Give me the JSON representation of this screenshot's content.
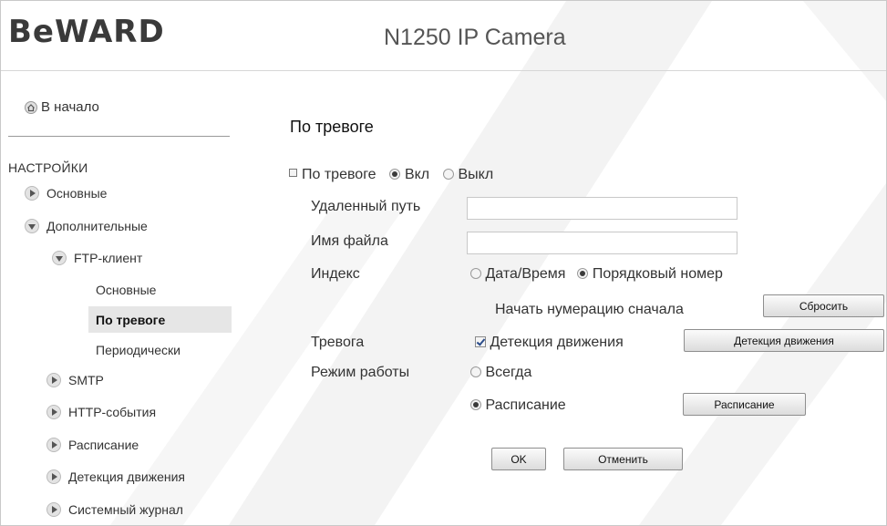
{
  "header": {
    "logo": "BeWARD",
    "title": "N1250 IP Camera"
  },
  "sidebar": {
    "home_label": "В начало",
    "section_title": "НАСТРОЙКИ",
    "items": [
      {
        "label": "Основные"
      },
      {
        "label": "Дополнительные"
      },
      {
        "label": "FTP-клиент"
      },
      {
        "label": "Основные"
      },
      {
        "label": "По тревоге"
      },
      {
        "label": "Периодически"
      },
      {
        "label": "SMTP"
      },
      {
        "label": "HTTP-события"
      },
      {
        "label": "Расписание"
      },
      {
        "label": "Детекция движения"
      },
      {
        "label": "Системный журнал"
      }
    ],
    "active_item": "По тревоге"
  },
  "form": {
    "title": "По тревоге",
    "alarm": {
      "label": "По тревоге",
      "on_label": "Вкл",
      "off_label": "Выкл",
      "value": "Вкл"
    },
    "remote_path": {
      "label": "Удаленный путь",
      "value": ""
    },
    "file_name": {
      "label": "Имя файла",
      "value": ""
    },
    "index": {
      "label": "Индекс",
      "option_datetime": "Дата/Время",
      "option_sequence": "Порядковый номер",
      "selected": "Порядковый номер",
      "reset_label": "Начать нумерацию сначала",
      "reset_button": "Сбросить"
    },
    "trigger": {
      "label": "Тревога",
      "motion_label": "Детекция движения",
      "motion_checked": true,
      "motion_button": "Детекция движения"
    },
    "mode": {
      "label": "Режим работы",
      "always_label": "Всегда",
      "schedule_label": "Расписание",
      "selected": "Расписание",
      "schedule_button": "Расписание"
    },
    "ok_button": "OK",
    "cancel_button": "Отменить"
  }
}
